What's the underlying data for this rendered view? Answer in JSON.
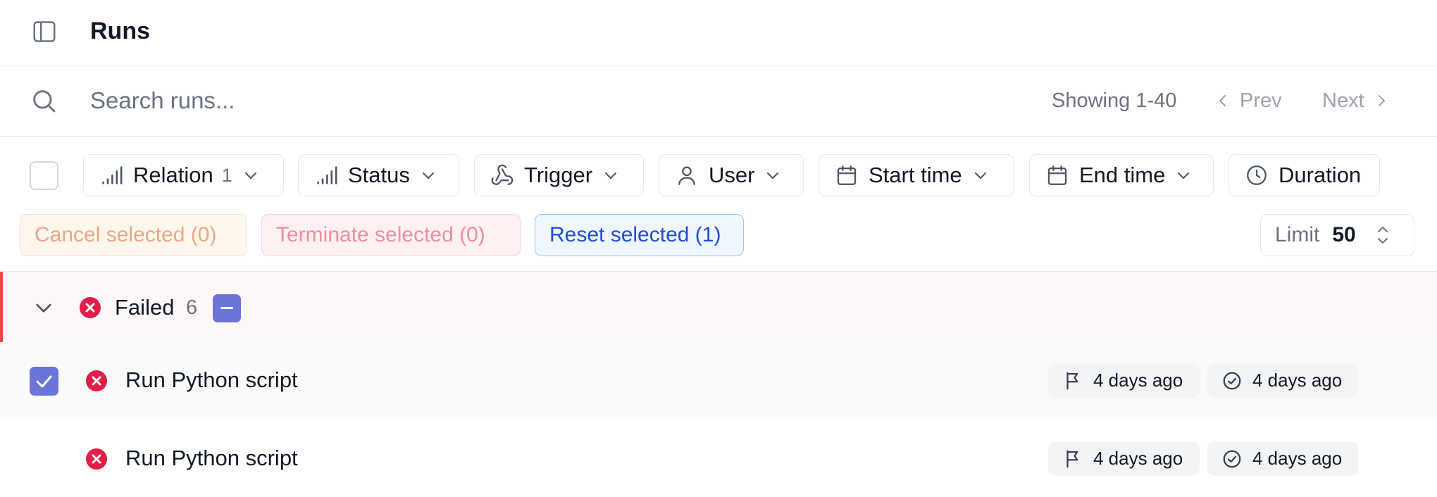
{
  "header": {
    "title": "Runs",
    "sidebar_toggle_icon": "sidebar-toggle-icon"
  },
  "search": {
    "placeholder": "Search runs...",
    "value": "",
    "showing": "Showing 1-40",
    "prev_label": "Prev",
    "next_label": "Next"
  },
  "filters": {
    "relation": {
      "label": "Relation",
      "count": "1",
      "icon": "signal-bars-icon"
    },
    "status": {
      "label": "Status",
      "icon": "signal-bars-icon"
    },
    "trigger": {
      "label": "Trigger",
      "icon": "webhook-icon"
    },
    "user": {
      "label": "User",
      "icon": "user-icon"
    },
    "start_time": {
      "label": "Start time",
      "icon": "calendar-icon"
    },
    "end_time": {
      "label": "End time",
      "icon": "calendar-icon"
    },
    "duration": {
      "label": "Duration",
      "icon": "clock-icon"
    }
  },
  "bulk_actions": {
    "cancel": "Cancel selected (0)",
    "terminate": "Terminate selected (0)",
    "reset": "Reset selected (1)"
  },
  "limit": {
    "label": "Limit",
    "value": "50"
  },
  "group": {
    "label": "Failed",
    "count": "6",
    "selection_state": "partial"
  },
  "rows": [
    {
      "name": "Run Python script",
      "status": "failed",
      "selected": true,
      "started": "4 days ago",
      "ended": "4 days ago"
    },
    {
      "name": "Run Python script",
      "status": "failed",
      "selected": false,
      "started": "4 days ago",
      "ended": "4 days ago"
    }
  ],
  "colors": {
    "failed": "#e11d48",
    "checkbox_accent": "#6b74d8",
    "reset_text": "#1d4ed8",
    "group_bg": "#fef7f7"
  }
}
